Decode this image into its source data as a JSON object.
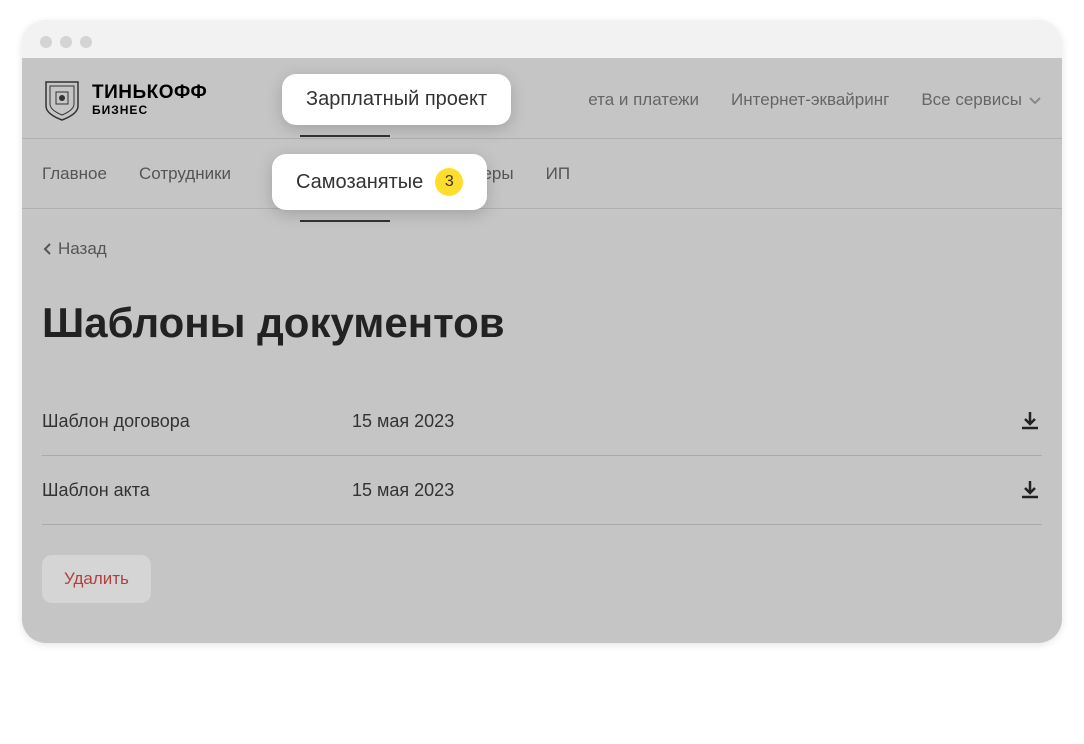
{
  "logo": {
    "main": "ТИНЬКОФФ",
    "sub": "БИЗНЕС"
  },
  "top_nav": {
    "payments": "ета и платежи",
    "acquiring": "Интернет-эквайринг",
    "all_services": "Все сервисы"
  },
  "sub_nav": {
    "main": "Главное",
    "employees": "Сотрудники",
    "ners_partial": "неры",
    "ip": "ИП"
  },
  "popups": {
    "salary_project": "Зарплатный проект",
    "self_employed": "Самозанятые",
    "badge_count": "3"
  },
  "back": {
    "label": "Назад"
  },
  "page": {
    "title": "Шаблоны документов"
  },
  "docs": [
    {
      "name": "Шаблон договора",
      "date": "15 мая 2023"
    },
    {
      "name": "Шаблон акта",
      "date": "15 мая 2023"
    }
  ],
  "actions": {
    "delete": "Удалить"
  }
}
